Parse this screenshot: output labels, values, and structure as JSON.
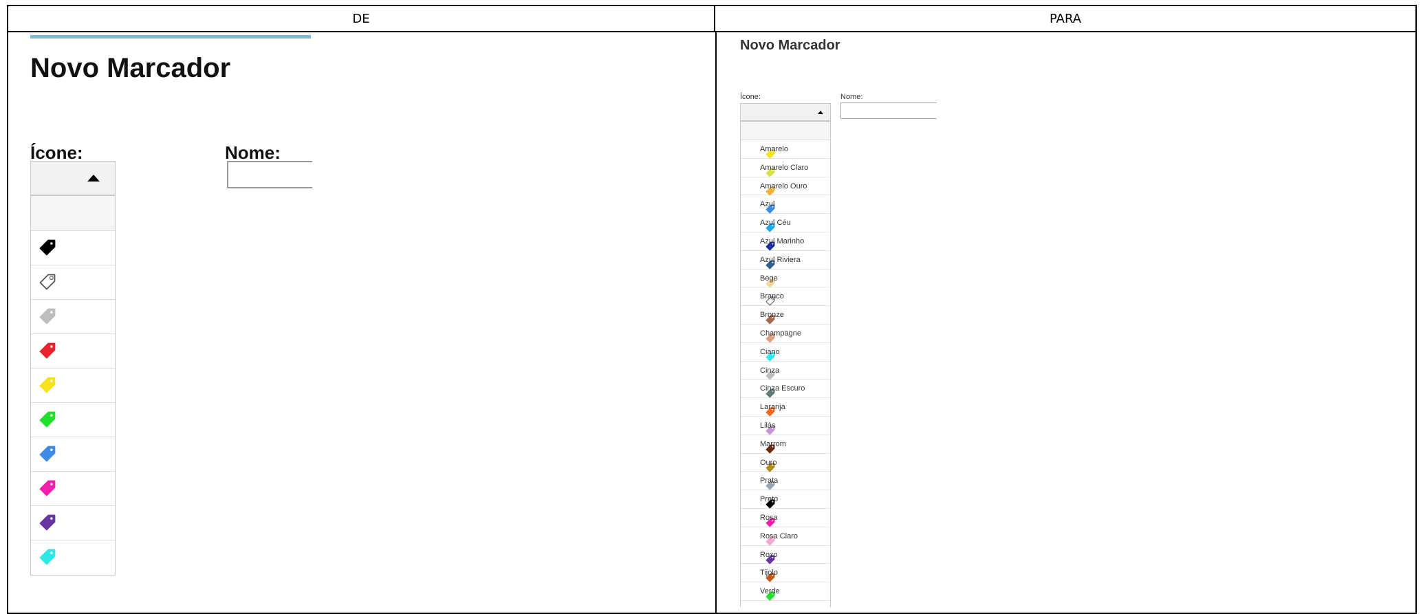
{
  "header": {
    "de": "DE",
    "para": "PARA"
  },
  "de": {
    "title": "Novo Marcador",
    "icone_label": "Ícone:",
    "nome_label": "Nome:",
    "tags": [
      {
        "color": "#000000"
      },
      {
        "color": "#ffffff"
      },
      {
        "color": "#bdbdbd"
      },
      {
        "color": "#e8232d"
      },
      {
        "color": "#f5e21b"
      },
      {
        "color": "#1fe02a"
      },
      {
        "color": "#3e8ae6"
      },
      {
        "color": "#f51fae"
      },
      {
        "color": "#6a34a0"
      },
      {
        "color": "#2ee8e8"
      }
    ]
  },
  "para": {
    "title": "Novo Marcador",
    "icone_label": "Ícone:",
    "nome_label": "Nome:",
    "tags": [
      {
        "label": "Amarelo",
        "color": "#f5e21b"
      },
      {
        "label": "Amarelo Claro",
        "color": "#d8e04a"
      },
      {
        "label": "Amarelo Ouro",
        "color": "#f2b233"
      },
      {
        "label": "Azul",
        "color": "#3e8ae6"
      },
      {
        "label": "Azul Céu",
        "color": "#20a8e8"
      },
      {
        "label": "Azul Marinho",
        "color": "#1b2f9c"
      },
      {
        "label": "Azul Riviera",
        "color": "#2f5f8f"
      },
      {
        "label": "Bege",
        "color": "#f5d49a"
      },
      {
        "label": "Branco",
        "color": "#ffffff"
      },
      {
        "label": "Bronze",
        "color": "#a5674a"
      },
      {
        "label": "Champagne",
        "color": "#e0a080"
      },
      {
        "label": "Ciano",
        "color": "#2ee8e8"
      },
      {
        "label": "Cinza",
        "color": "#bdbdbd"
      },
      {
        "label": "Cinza Escuro",
        "color": "#5e7a7a"
      },
      {
        "label": "Laranja",
        "color": "#f26a1b"
      },
      {
        "label": "Lilás",
        "color": "#c895d8"
      },
      {
        "label": "Marrom",
        "color": "#6a2a10"
      },
      {
        "label": "Ouro",
        "color": "#b38a1b"
      },
      {
        "label": "Prata",
        "color": "#9aa6ae"
      },
      {
        "label": "Preto",
        "color": "#000000"
      },
      {
        "label": "Rosa",
        "color": "#f51fae"
      },
      {
        "label": "Rosa Claro",
        "color": "#f5a8d0"
      },
      {
        "label": "Roxo",
        "color": "#6a34a0"
      },
      {
        "label": "Tijolo",
        "color": "#c4581b"
      },
      {
        "label": "Verde",
        "color": "#1fe02a"
      },
      {
        "label": "",
        "color": "#7ccf7c"
      }
    ]
  }
}
